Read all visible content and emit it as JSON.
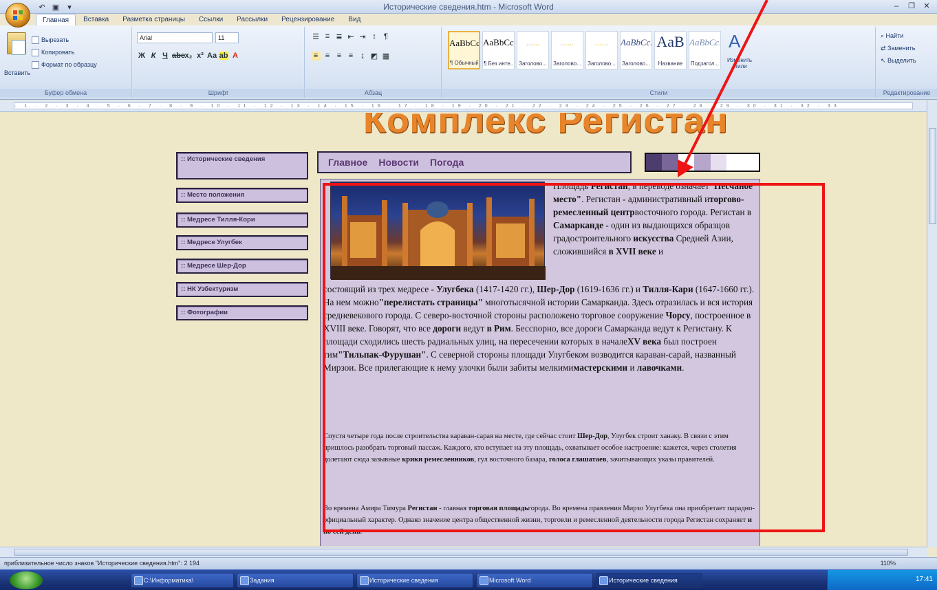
{
  "window": {
    "title": "Исторические сведения.htm - Microsoft Word"
  },
  "colors": {
    "annotation": "#ee1414",
    "accent": "#e8852b",
    "nav_bg": "#cdbfde"
  },
  "ribbon": {
    "tabs": [
      "Главная",
      "Вставка",
      "Разметка страницы",
      "Ссылки",
      "Рассылки",
      "Рецензирование",
      "Вид"
    ],
    "clipboard": {
      "paste": "Вставить",
      "cut": "Вырезать",
      "copy": "Копировать",
      "format_painter": "Формат по образцу",
      "label": "Буфер обмена"
    },
    "font": {
      "name": "Arial",
      "size": "11",
      "label": "Шрифт"
    },
    "paragraph": {
      "label": "Абзац"
    },
    "styles": {
      "label": "Стили",
      "items": [
        {
          "preview": "AaBbCcI",
          "name": "¶ Обычный"
        },
        {
          "preview": "AaBbCcI",
          "name": "¶ Без инте..."
        },
        {
          "preview": "......",
          "name": "Заголово..."
        },
        {
          "preview": "......",
          "name": "Заголово..."
        },
        {
          "preview": "......",
          "name": "Заголово..."
        },
        {
          "preview": "AaBbCcI",
          "name": "Заголово..."
        },
        {
          "preview": "AaB",
          "name": "Название"
        },
        {
          "preview": "AaBbCc.",
          "name": "Подзагол..."
        }
      ],
      "change": "Изменить стили"
    },
    "editing": {
      "find": "Найти",
      "replace": "Заменить",
      "select": "Выделить",
      "label": "Редактирование"
    }
  },
  "document": {
    "banner": "Комплекс Регистан",
    "sidebar": [
      ":: Исторические сведения",
      ":: Место положения",
      ":: Медресе Тилля-Кори",
      ":: Медресе Улугбек",
      ":: Медресе Шер-Дор",
      ":: НК Узбектуризм",
      ":: Фотографии"
    ],
    "topnav": [
      "Главное",
      "Новости",
      "Погода"
    ],
    "swatch_colors": [
      "#4d3c6e",
      "#7a6698",
      "#ffffff",
      "#b6a6cc",
      "#e7dff0",
      "#ffffff",
      "#ffffff"
    ],
    "p1": {
      "t1": "Площадь ",
      "b1": "Регистан",
      "t2": ", в переводе означает",
      "b2": "\"Песчаное место\"",
      "t3": ". Регистан - административный и",
      "b3": "торгово-ремесленный центр",
      "t4": "восточного города. Регистан в ",
      "b4": "Самарканде",
      "t5": " - один из выдающихся образцов градостроительного ",
      "b5": "искусства",
      "t6": " Средней Азии, сложившийся ",
      "b6": "в XVII веке",
      "t7": " и"
    },
    "p1b": {
      "t1": "состоящий из трех медресе - ",
      "b1": "Улугбека",
      "t2": " (1417-1420 гг.), ",
      "b2": "Шер-Дор",
      "t3": " (1619-1636 гг.) и ",
      "b3": "Тилля-Кари",
      "t4": " (1647-1660 гг.). На нем можно",
      "b4": "\"перелистать страницы\"",
      "t5": " многотысячной истории Самарканда. Здесь отразилась и вся история средневекового города. С северо-восточной стороны расположено торговое сооружение ",
      "b5": "Чорсу",
      "t6": ", построенное в XVIII веке. Говорят, что все ",
      "b6": "дороги",
      "t7": " ведут ",
      "b7": "в Рим",
      "t8": ". Бесспорно, все дороги Самарканда ведут к Регистану. К площади сходились шесть радиальных улиц, на пересечении которых в начале",
      "b8": "XV века",
      "t9": " был построен тим",
      "b9": "\"Тильпак-Фурушан\"",
      "t10": ". С северной стороны площади Улугбеком возводится караван-сарай, названный Мирзои. Все прилегающие к нему улочки были забиты мелкими",
      "b10": "мастерскими",
      "t11": " и ",
      "b11": "лавочками",
      "t12": "."
    },
    "p2": {
      "t1": "Спустя четыре года после строительства караван-сарая на месте, где сейчас стоит ",
      "b1": "Шер-Дор",
      "t2": ", Улугбек строит ханаку. В связи с этим пришлось разобрать торговый пассаж. Каждого, кто вступает на эту площадь, охватывает особое настроение: кажется, через столетия долетают сюда зазывные ",
      "b2": "крики ремесленников",
      "t3": ", гул восточного базара, ",
      "b3": "голоса глашатаев",
      "t4": ", зачитывающих указы правителей."
    },
    "p3": {
      "t1": "Во времена Амира Тимура ",
      "b1": "Регистан",
      "t2": " - главная ",
      "b2": "торговая площадь",
      "t3": "города. Во времена правления Мирзо Улугбека она приобретает парадно-официальный характер. Однако значение центра общественной жизни, торговли и ремесленной деятельности города Регистан сохраняет ",
      "b3": "и по сей день",
      "t4": "."
    }
  },
  "status": {
    "text": "приблизительное число знаков \"Исторические сведения.htm\": 2 194",
    "zoom": "110%"
  },
  "taskbar": {
    "items": [
      "C:\\Информатика\\",
      "Задания",
      "Исторические сведения",
      "Microsoft Word",
      "Исторические сведения"
    ],
    "clock": "17:41"
  }
}
